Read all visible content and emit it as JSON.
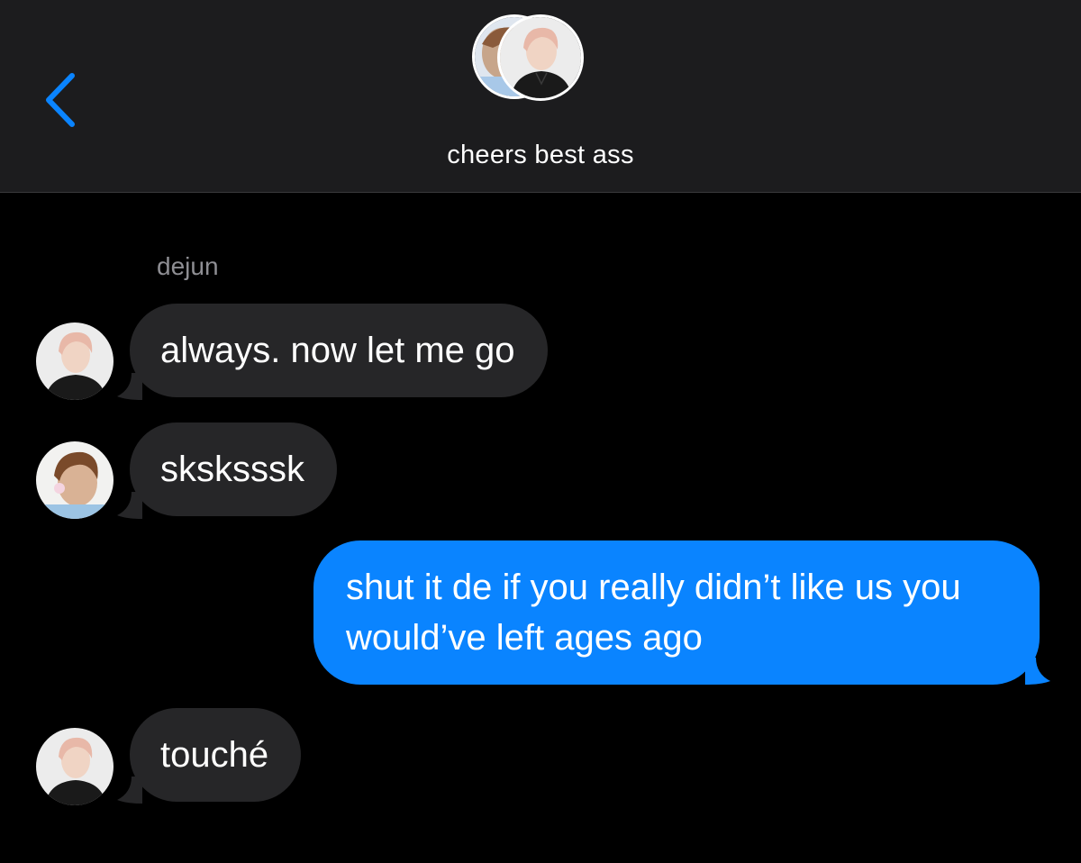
{
  "header": {
    "back_icon": "chevron-left-icon",
    "title": "cheers best ass",
    "accent_color": "#0a84ff"
  },
  "conversation": {
    "sender_label": "dejun",
    "messages": [
      {
        "direction": "incoming",
        "text": "always. now let me go",
        "avatar": "avatar-pink-hair"
      },
      {
        "direction": "incoming",
        "text": "sksksssk",
        "avatar": "avatar-brown-hair"
      },
      {
        "direction": "outgoing",
        "text": "shut it de if you really didn’t like us you would’ve left ages ago"
      },
      {
        "direction": "incoming",
        "text": "touché",
        "avatar": "avatar-pink-hair"
      }
    ]
  },
  "colors": {
    "background": "#000000",
    "header_background": "#1c1c1e",
    "incoming_bubble": "#262628",
    "outgoing_bubble": "#0a84ff",
    "sender_label": "#8e8e93"
  }
}
